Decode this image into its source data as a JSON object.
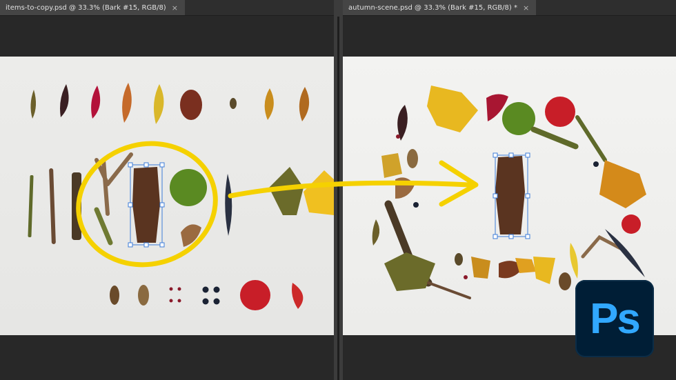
{
  "documents": [
    {
      "tab_title": "items-to-copy.psd @ 33.3% (Bark #15, RGB/8)",
      "close_glyph": "×"
    },
    {
      "tab_title": "autumn-scene.psd @ 33.3% (Bark #15, RGB/8) *",
      "close_glyph": "×"
    }
  ],
  "logo": {
    "text": "Ps",
    "background": "#001e36",
    "color": "#31a8ff"
  },
  "colors": {
    "workspace": "#282828",
    "tab_active": "#454545",
    "selection": "#3b7bd8",
    "annotation": "#f5d100"
  }
}
